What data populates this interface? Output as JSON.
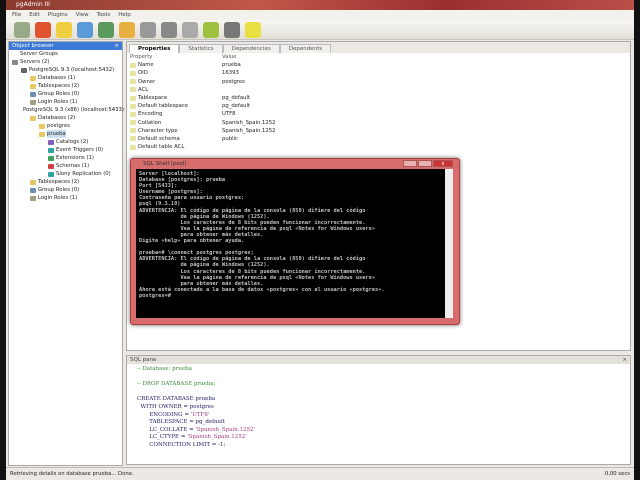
{
  "window": {
    "title": "pgAdmin III"
  },
  "menu": [
    "File",
    "Edit",
    "Plugins",
    "View",
    "Tools",
    "Help"
  ],
  "toolbar": {
    "icons": [
      "connect-icon",
      "refresh-icon",
      "folder-icon",
      "copy-icon",
      "delete-icon",
      "sql-query-icon",
      "view-data-icon",
      "filter-data-icon",
      "maintenance-icon",
      "plugins-icon",
      "hint-icon",
      "help-icon"
    ]
  },
  "object_browser": {
    "title": "Object browser",
    "close": "×",
    "tree": [
      {
        "label": "Server Groups",
        "level": 0,
        "color": "#fff"
      },
      {
        "label": "Servers (2)",
        "level": 0,
        "color": "#888"
      },
      {
        "label": "PostgreSQL 9.3 (localhost:5432)",
        "level": 1,
        "color": "#666"
      },
      {
        "label": "Databases (1)",
        "level": 2,
        "color": "#e8c860"
      },
      {
        "label": "Tablespaces (2)",
        "level": 2,
        "color": "#e8c860"
      },
      {
        "label": "Group Roles (0)",
        "level": 2,
        "color": "#7090b0"
      },
      {
        "label": "Login Roles (1)",
        "level": 2,
        "color": "#a0a080"
      },
      {
        "label": "PostgreSQL 9.3 (x86) (localhost:5433)",
        "level": 1,
        "color": "#666"
      },
      {
        "label": "Databases (2)",
        "level": 2,
        "color": "#e8c860"
      },
      {
        "label": "postgres",
        "level": 3,
        "color": "#e8c860"
      },
      {
        "label": "prueba",
        "level": 3,
        "color": "#e8c860",
        "selected": true
      },
      {
        "label": "Catalogs (2)",
        "level": 4,
        "color": "#8060c0"
      },
      {
        "label": "Event Triggers (0)",
        "level": 4,
        "color": "#30a0a0"
      },
      {
        "label": "Extensions (1)",
        "level": 4,
        "color": "#40a060"
      },
      {
        "label": "Schemas (1)",
        "level": 4,
        "color": "#d04040"
      },
      {
        "label": "Slony Replication (0)",
        "level": 4,
        "color": "#30a0a0"
      },
      {
        "label": "Tablespaces (2)",
        "level": 2,
        "color": "#e8c860"
      },
      {
        "label": "Group Roles (0)",
        "level": 2,
        "color": "#7090b0"
      },
      {
        "label": "Login Roles (1)",
        "level": 2,
        "color": "#a0a080"
      }
    ]
  },
  "tabs": [
    {
      "label": "Properties",
      "active": true
    },
    {
      "label": "Statistics"
    },
    {
      "label": "Dependencies"
    },
    {
      "label": "Dependents"
    }
  ],
  "properties": {
    "header": [
      "Property",
      "Value"
    ],
    "rows": [
      [
        "Name",
        "prueba"
      ],
      [
        "OID",
        "16393"
      ],
      [
        "Owner",
        "postgres"
      ],
      [
        "ACL",
        ""
      ],
      [
        "Tablespace",
        "pg_default"
      ],
      [
        "Default tablespace",
        "pg_default"
      ],
      [
        "Encoding",
        "UTF8"
      ],
      [
        "Collation",
        "Spanish_Spain.1252"
      ],
      [
        "Character type",
        "Spanish_Spain.1252"
      ],
      [
        "Default schema",
        "public"
      ],
      [
        "Default table ACL",
        ""
      ]
    ]
  },
  "console": {
    "title": "SQL Shell (psql)",
    "close": "x",
    "text": "Server [localhost]:\nDatabase [postgres]: prueba\nPort [5433]:\nUsername [postgres]:\nContraseña para usuario postgres:\npsql (9.3.10)\nADVERTENCIA: El código de página de la consola (850) difiere del código\n             de página de Windows (1252).\n             Los caracteres de 8 bits pueden funcionar incorrectamente.\n             Vea la página de referencia de psql «Notes for Windows users»\n             para obtener más detalles.\nDigite «help» para obtener ayuda.\n\nprueba=# \\connect postgres postgres;\nADVERTENCIA: El código de página de la consola (850) difiere del código\n             de página de Windows (1252).\n             Los caracteres de 8 bits pueden funcionar incorrectamente.\n             Vea la página de referencia de psql «Notes for Windows users»\n             para obtener más detalles.\nAhora está conectado a la base de datos «postgres» con el usuario «postgres».\npostgres=#"
  },
  "sql_pane": {
    "title": "SQL pane",
    "close": "×",
    "comment1": "-- Database: prueba",
    "comment2": "-- DROP DATABASE prueba;",
    "l1": "CREATE DATABASE prueba",
    "l2": "  WITH OWNER = postgres",
    "l3": "       ENCODING = ",
    "l3s": "'UTF8'",
    "l4": "       TABLESPACE = pg_default",
    "l5": "       LC_COLLATE = ",
    "l5s": "'Spanish_Spain.1252'",
    "l6": "       LC_CTYPE = ",
    "l6s": "'Spanish_Spain.1252'",
    "l7": "       CONNECTION LIMIT = -1;"
  },
  "status": {
    "message": "Retrieving details on database prueba... Done.",
    "time": "0,00 secs"
  }
}
